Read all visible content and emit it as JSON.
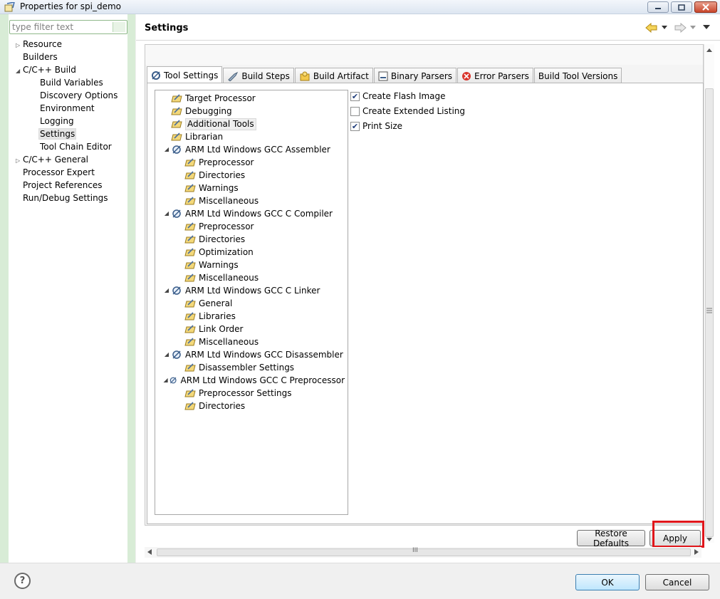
{
  "window": {
    "title": "Properties for spi_demo",
    "app_icon": "eclipse-properties-icon"
  },
  "filter": {
    "placeholder": "type filter text"
  },
  "sidebar": {
    "items": [
      {
        "label": "Resource",
        "indent": 0,
        "expander": "collapsed"
      },
      {
        "label": "Builders",
        "indent": 0,
        "expander": "none"
      },
      {
        "label": "C/C++ Build",
        "indent": 0,
        "expander": "expanded"
      },
      {
        "label": "Build Variables",
        "indent": 1,
        "expander": "none"
      },
      {
        "label": "Discovery Options",
        "indent": 1,
        "expander": "none"
      },
      {
        "label": "Environment",
        "indent": 1,
        "expander": "none"
      },
      {
        "label": "Logging",
        "indent": 1,
        "expander": "none"
      },
      {
        "label": "Settings",
        "indent": 1,
        "expander": "none",
        "selected": true
      },
      {
        "label": "Tool Chain Editor",
        "indent": 1,
        "expander": "none"
      },
      {
        "label": "C/C++ General",
        "indent": 0,
        "expander": "collapsed"
      },
      {
        "label": "Processor Expert",
        "indent": 0,
        "expander": "none"
      },
      {
        "label": "Project References",
        "indent": 0,
        "expander": "none"
      },
      {
        "label": "Run/Debug Settings",
        "indent": 0,
        "expander": "none"
      }
    ]
  },
  "page": {
    "title": "Settings"
  },
  "tabs": [
    {
      "label": "Tool Settings",
      "icon": "tool-settings-icon",
      "active": true
    },
    {
      "label": "Build Steps",
      "icon": "build-steps-icon"
    },
    {
      "label": "Build Artifact",
      "icon": "build-artifact-icon"
    },
    {
      "label": "Binary Parsers",
      "icon": "binary-parsers-icon"
    },
    {
      "label": "Error Parsers",
      "icon": "error-parsers-icon"
    },
    {
      "label": "Build Tool Versions",
      "icon": ""
    }
  ],
  "tree": [
    {
      "label": "Target Processor",
      "level": 0,
      "type": "leaf"
    },
    {
      "label": "Debugging",
      "level": 0,
      "type": "leaf"
    },
    {
      "label": "Additional Tools",
      "level": 0,
      "type": "leaf",
      "selected": true
    },
    {
      "label": "Librarian",
      "level": 0,
      "type": "leaf"
    },
    {
      "label": "ARM Ltd Windows GCC Assembler",
      "level": 0,
      "type": "tool"
    },
    {
      "label": "Preprocessor",
      "level": 1,
      "type": "leaf"
    },
    {
      "label": "Directories",
      "level": 1,
      "type": "leaf"
    },
    {
      "label": "Warnings",
      "level": 1,
      "type": "leaf"
    },
    {
      "label": "Miscellaneous",
      "level": 1,
      "type": "leaf"
    },
    {
      "label": "ARM Ltd Windows GCC C Compiler",
      "level": 0,
      "type": "tool"
    },
    {
      "label": "Preprocessor",
      "level": 1,
      "type": "leaf"
    },
    {
      "label": "Directories",
      "level": 1,
      "type": "leaf"
    },
    {
      "label": "Optimization",
      "level": 1,
      "type": "leaf"
    },
    {
      "label": "Warnings",
      "level": 1,
      "type": "leaf"
    },
    {
      "label": "Miscellaneous",
      "level": 1,
      "type": "leaf"
    },
    {
      "label": "ARM Ltd Windows GCC C Linker",
      "level": 0,
      "type": "tool"
    },
    {
      "label": "General",
      "level": 1,
      "type": "leaf"
    },
    {
      "label": "Libraries",
      "level": 1,
      "type": "leaf"
    },
    {
      "label": "Link Order",
      "level": 1,
      "type": "leaf"
    },
    {
      "label": "Miscellaneous",
      "level": 1,
      "type": "leaf"
    },
    {
      "label": "ARM Ltd Windows GCC Disassembler",
      "level": 0,
      "type": "tool"
    },
    {
      "label": "Disassembler Settings",
      "level": 1,
      "type": "leaf"
    },
    {
      "label": "ARM Ltd Windows GCC C Preprocessor",
      "level": 0,
      "type": "tool"
    },
    {
      "label": "Preprocessor Settings",
      "level": 1,
      "type": "leaf"
    },
    {
      "label": "Directories",
      "level": 1,
      "type": "leaf"
    }
  ],
  "options": [
    {
      "label": "Create Flash Image",
      "checked": true
    },
    {
      "label": "Create Extended Listing",
      "checked": false
    },
    {
      "label": "Print Size",
      "checked": true
    }
  ],
  "buttons": {
    "restore_defaults": "Restore Defaults",
    "apply": "Apply",
    "ok": "OK",
    "cancel": "Cancel",
    "help": "?"
  },
  "scrollbar": {
    "grip": "III"
  },
  "colors": {
    "highlight": "#e0161b",
    "sidebar_accent": "#d8ecd6"
  }
}
